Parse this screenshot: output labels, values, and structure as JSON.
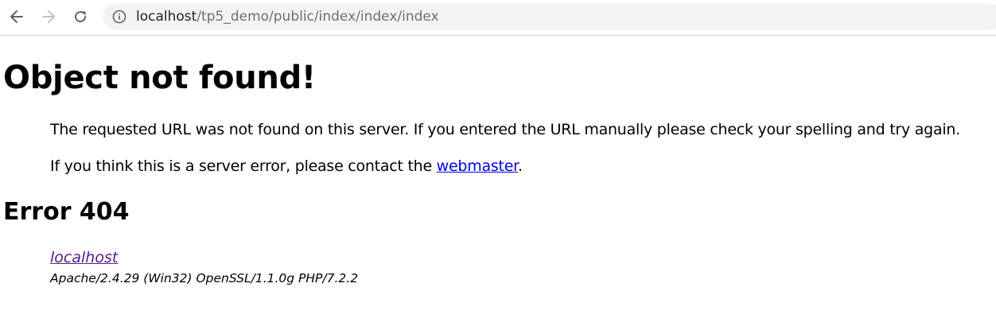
{
  "browser": {
    "url_host": "localhost",
    "url_path": "/tp5_demo/public/index/index/index",
    "icons": {
      "back": "arrow-left-icon",
      "forward": "arrow-right-icon",
      "reload": "reload-icon",
      "site_info": "info-circle-icon"
    }
  },
  "page": {
    "title": "Object not found!",
    "message_line1": "The requested URL was not found on this server. If you entered the URL manually please check your spelling and try again.",
    "message_line2_prefix": "If you think this is a server error, please contact the ",
    "webmaster_link": "webmaster",
    "message_line2_suffix": ".",
    "error_heading": "Error 404",
    "host_link": "localhost",
    "server_signature": "Apache/2.4.29 (Win32) OpenSSL/1.1.0g PHP/7.2.2"
  },
  "colors": {
    "link": "#0000ee",
    "visited_link": "#551a8b",
    "omnibox_bg": "#f1f3f4",
    "url_path": "#6f6f6f"
  }
}
